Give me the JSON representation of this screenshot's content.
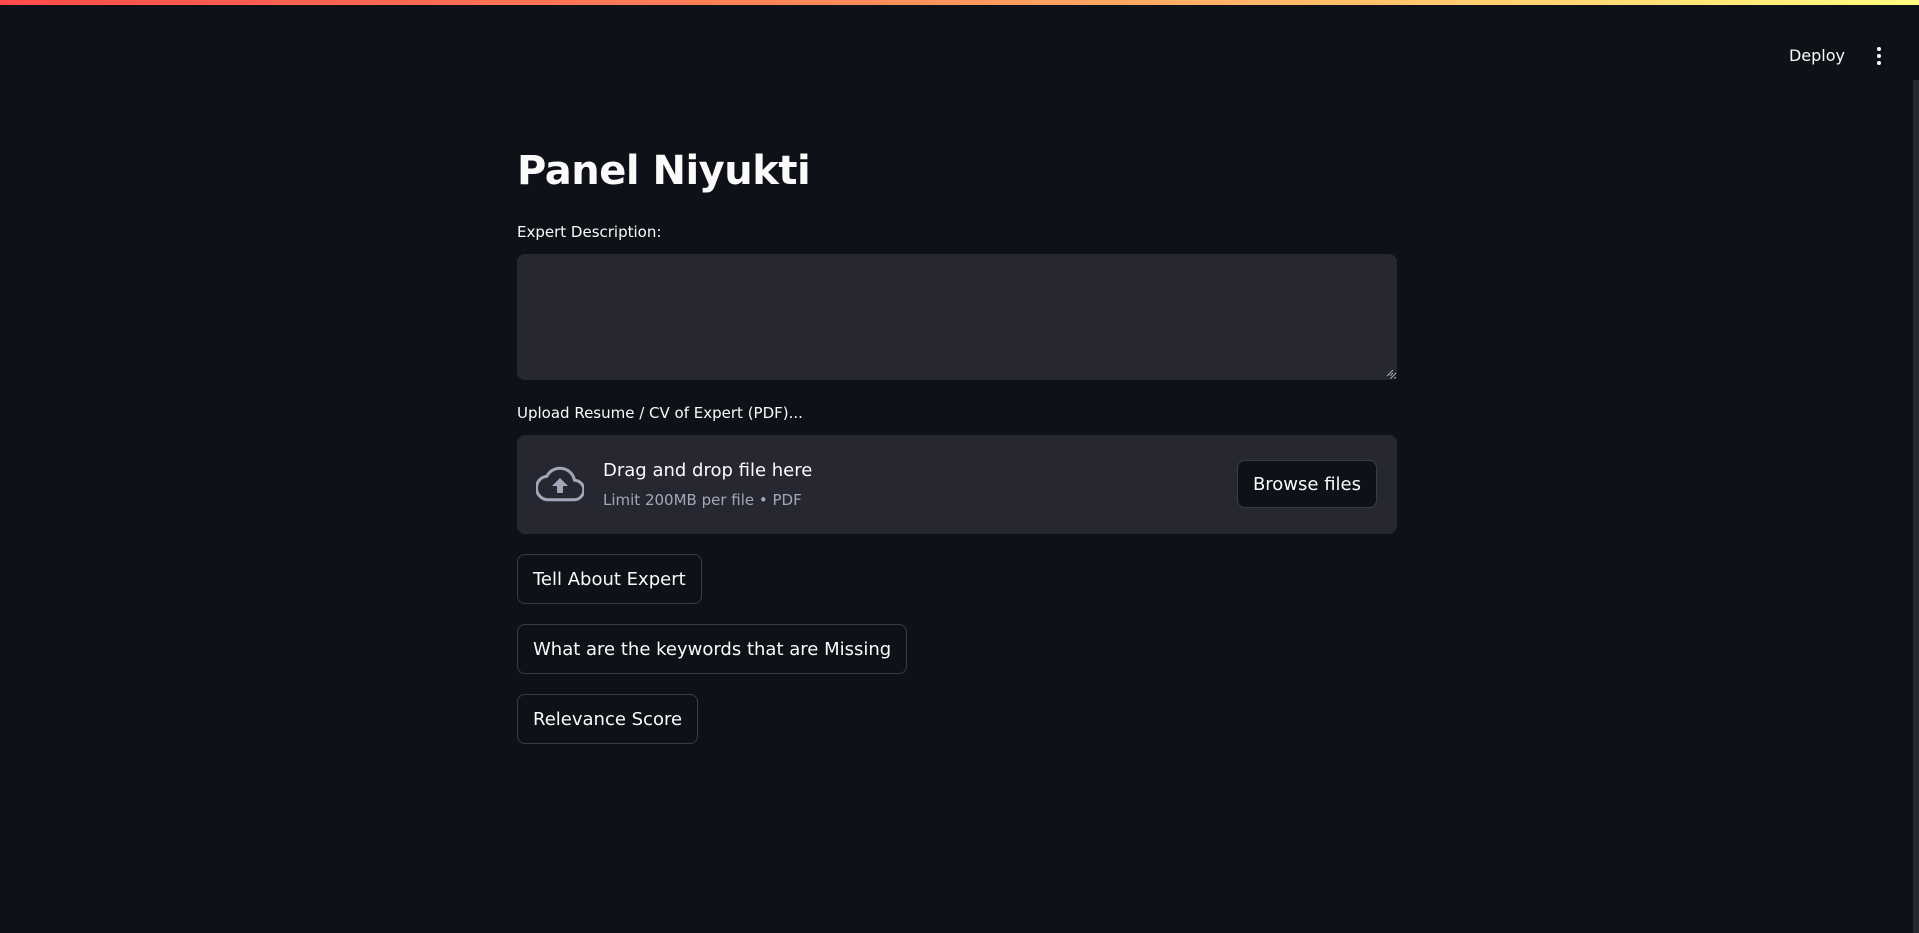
{
  "header": {
    "deploy_label": "Deploy",
    "menu_icon": "vertical-ellipsis-icon"
  },
  "main": {
    "title": "Panel Niyukti",
    "description_label": "Expert Description:",
    "description_value": "",
    "upload_label": "Upload Resume / CV of Expert (PDF)...",
    "dropzone": {
      "icon": "cloud-upload-icon",
      "title": "Drag and drop file here",
      "subtitle": "Limit 200MB per file • PDF",
      "browse_label": "Browse files"
    },
    "buttons": {
      "tell_about": "Tell About Expert",
      "missing_keywords": "What are the keywords that are Missing",
      "relevance_score": "Relevance Score"
    }
  },
  "colors": {
    "background": "#0e1117",
    "input_background": "#262730",
    "text": "#fafafa",
    "muted_text": "#a3a8b8",
    "button_border": "#3a3c47",
    "accent_gradient_start": "#ff4b4b",
    "accent_gradient_end": "#fffd80"
  }
}
